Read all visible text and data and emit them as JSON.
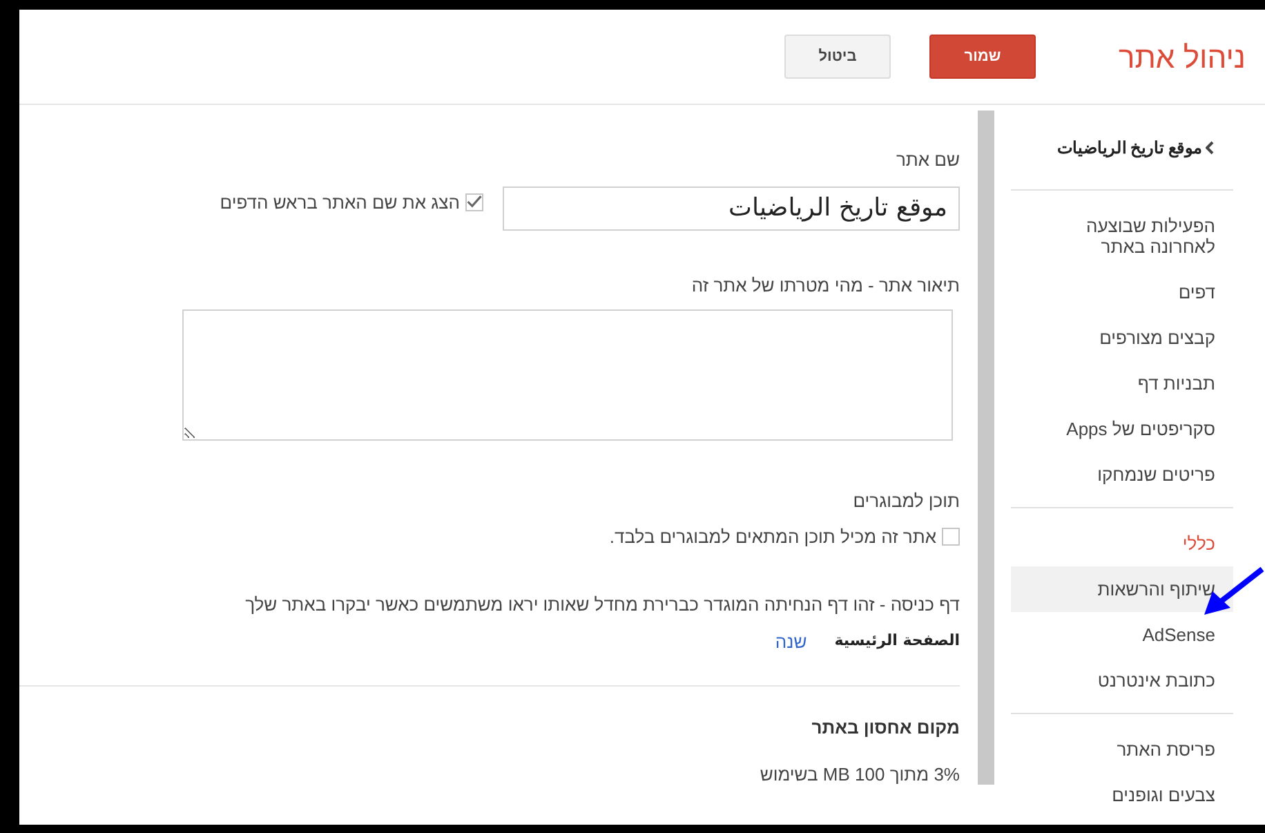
{
  "header": {
    "title": "ניהול אתר",
    "buttons": [
      {
        "label": "שמור",
        "kind": "primary"
      },
      {
        "label": "ביטול",
        "kind": "secondary"
      }
    ]
  },
  "sidebar": {
    "back_link": "موقع تاريخ الرياضيات",
    "groups": [
      {
        "items": [
          {
            "label": "הפעילות שבוצעה לאחרונה באתר",
            "selected": false,
            "highlighted": false
          },
          {
            "label": "דפים",
            "selected": false,
            "highlighted": false
          },
          {
            "label": "קבצים מצורפים",
            "selected": false,
            "highlighted": false
          },
          {
            "label": "תבניות דף",
            "selected": false,
            "highlighted": false
          },
          {
            "label": "סקריפטים של Apps",
            "selected": false,
            "highlighted": false
          },
          {
            "label": "פריטים שנמחקו",
            "selected": false,
            "highlighted": false
          }
        ]
      },
      {
        "items": [
          {
            "label": "כללי",
            "selected": true,
            "highlighted": false
          },
          {
            "label": "שיתוף והרשאות",
            "selected": false,
            "highlighted": true
          },
          {
            "label": "AdSense",
            "selected": false,
            "highlighted": false
          },
          {
            "label": "כתובת אינטרנט",
            "selected": false,
            "highlighted": false
          }
        ]
      },
      {
        "items": [
          {
            "label": "פריסת האתר",
            "selected": false,
            "highlighted": false
          },
          {
            "label": "צבעים וגופנים",
            "selected": false,
            "highlighted": false
          }
        ]
      }
    ]
  },
  "site_name": {
    "label": "שם אתר",
    "value": "موقع تاريخ الرياضيات",
    "show_in_header": {
      "label": "הצג את שם האתר בראש הדפים",
      "checked": true
    }
  },
  "description": {
    "label": "תיאור אתר - מהי מטרתו של אתר זה"
  },
  "adult_content": {
    "label": "תוכן למבוגרים",
    "option": {
      "label": "אתר זה מכיל תוכן המתאים למבוגרים בלבד.",
      "checked": false
    }
  },
  "landing_page": {
    "label": "דף כניסה - זהו דף הנחיתה המוגדר כברירת מחדל שאותו יראו משתמשים כאשר יבקרו באתר שלך",
    "value": "الصفحة الرئيسية",
    "change_link": "שנה"
  },
  "storage": {
    "title": "מקום אחסון באתר",
    "usage": "3% מתוך 100 MB בשימוש"
  }
}
